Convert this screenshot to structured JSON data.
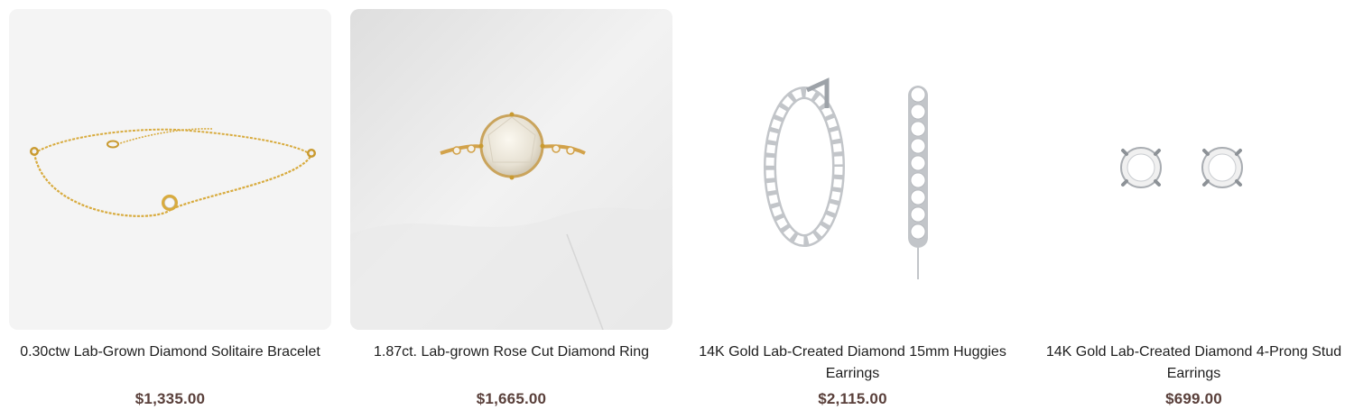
{
  "products": [
    {
      "title": "0.30ctw Lab-Grown Diamond Solitaire Bracelet",
      "price": "$1,335.00",
      "image": "bracelet-image",
      "bg": "#f4f4f4"
    },
    {
      "title": "1.87ct. Lab-grown Rose Cut Diamond Ring",
      "price": "$1,665.00",
      "image": "ring-image",
      "bg": "#ececec"
    },
    {
      "title": "14K Gold Lab-Created Diamond 15mm Huggies Earrings",
      "price": "$2,115.00",
      "image": "hoop-earrings-image",
      "bg": "#ffffff"
    },
    {
      "title": "14K Gold Lab-Created Diamond 4-Prong Stud Earrings",
      "price": "$699.00",
      "image": "stud-earrings-image",
      "bg": "#ffffff"
    }
  ],
  "colors": {
    "price": "#5a403b",
    "title": "#1e1e1e",
    "gold": "#d8ab3e",
    "silver": "#b9bcc0"
  }
}
